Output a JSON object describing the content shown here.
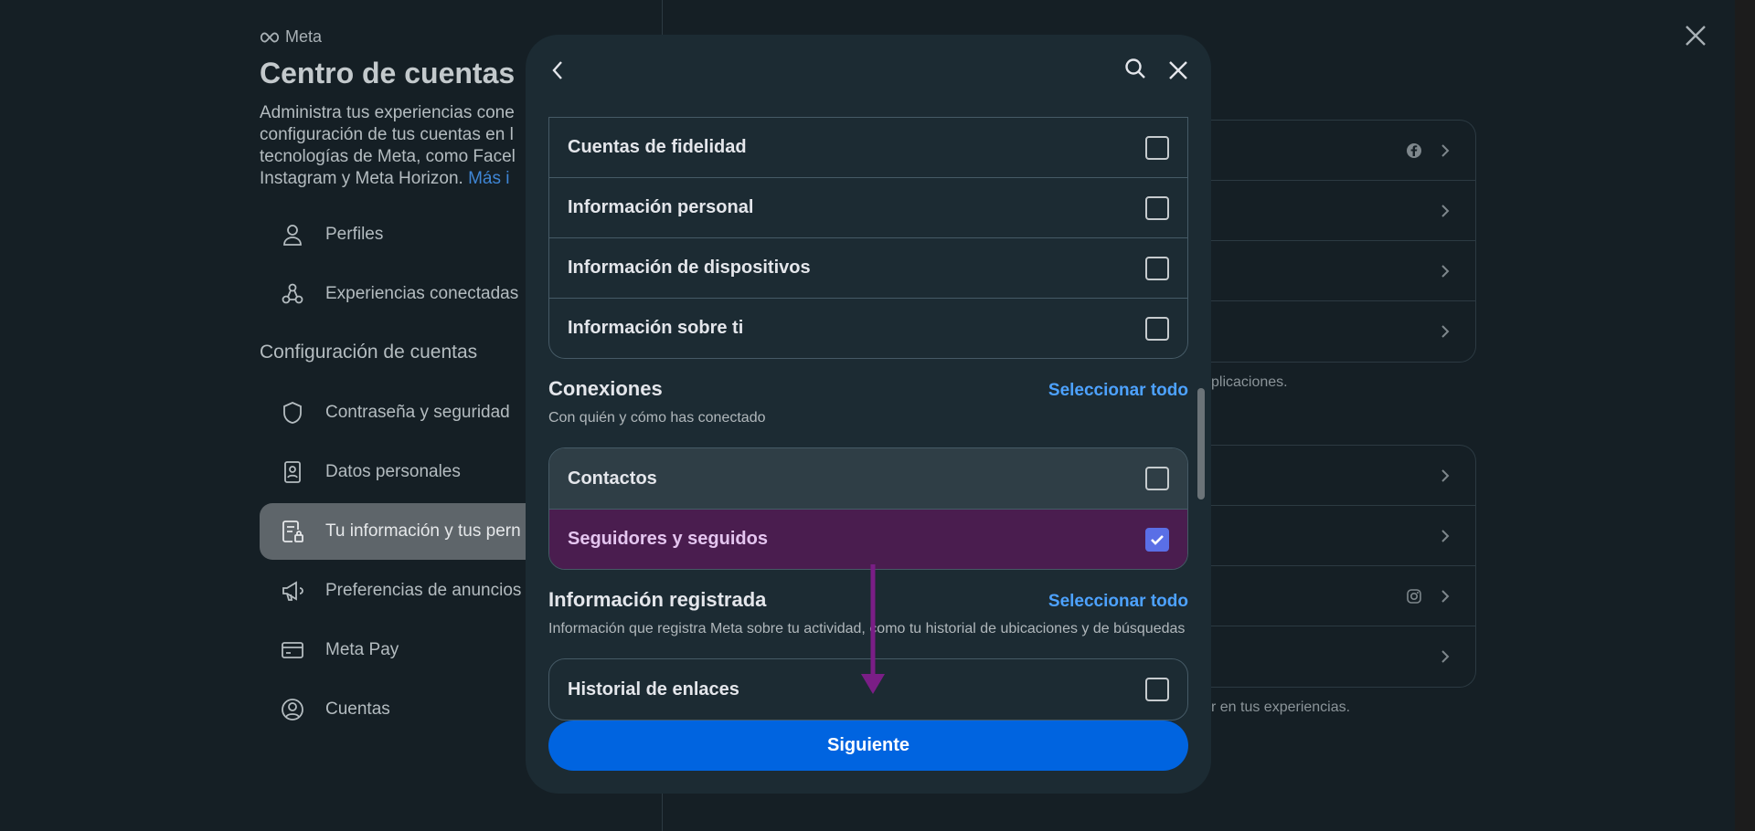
{
  "background": {
    "brand": "Meta",
    "title": "Centro de cuentas",
    "description": "Administra tus experiencias cone configuración de tus cuentas en l tecnologías de Meta, como Facel Instagram y Meta Horizon.",
    "more_link": "Más i",
    "nav": [
      {
        "label": "Perfiles",
        "icon": "person-icon"
      },
      {
        "label": "Experiencias conectadas",
        "icon": "connected-icon"
      }
    ],
    "section_label": "Configuración de cuentas",
    "settings": [
      {
        "label": "Contraseña y seguridad",
        "icon": "shield-icon"
      },
      {
        "label": "Datos personales",
        "icon": "id-card-icon"
      },
      {
        "label": "Tu información y tus pern",
        "icon": "info-lock-icon",
        "active": true
      },
      {
        "label": "Preferencias de anuncios",
        "icon": "megaphone-icon"
      },
      {
        "label": "Meta Pay",
        "icon": "card-icon"
      },
      {
        "label": "Cuentas",
        "icon": "account-circle-icon"
      }
    ],
    "right_note_1": "plicaciones.",
    "right_note_2": "r en tus experiencias."
  },
  "modal": {
    "top_items": [
      {
        "label": "Cuentas de fidelidad",
        "checked": false
      },
      {
        "label": "Información personal",
        "checked": false
      },
      {
        "label": "Información de dispositivos",
        "checked": false
      },
      {
        "label": "Información sobre ti",
        "checked": false
      }
    ],
    "connections": {
      "title": "Conexiones",
      "select_all": "Seleccionar todo",
      "subtitle": "Con quién y cómo has conectado",
      "items": [
        {
          "label": "Contactos",
          "checked": false
        },
        {
          "label": "Seguidores y seguidos",
          "checked": true
        }
      ]
    },
    "registered": {
      "title": "Información registrada",
      "select_all": "Seleccionar todo",
      "subtitle": "Información que registra Meta sobre tu actividad, como tu historial de ubicaciones y de búsquedas",
      "items": [
        {
          "label": "Historial de enlaces",
          "checked": false
        }
      ]
    },
    "next_button": "Siguiente"
  },
  "colors": {
    "accent": "#0064e0",
    "link": "#4da2ff",
    "selected_bg": "#4a1d4f",
    "annotation_arrow": "#7a1e86"
  }
}
